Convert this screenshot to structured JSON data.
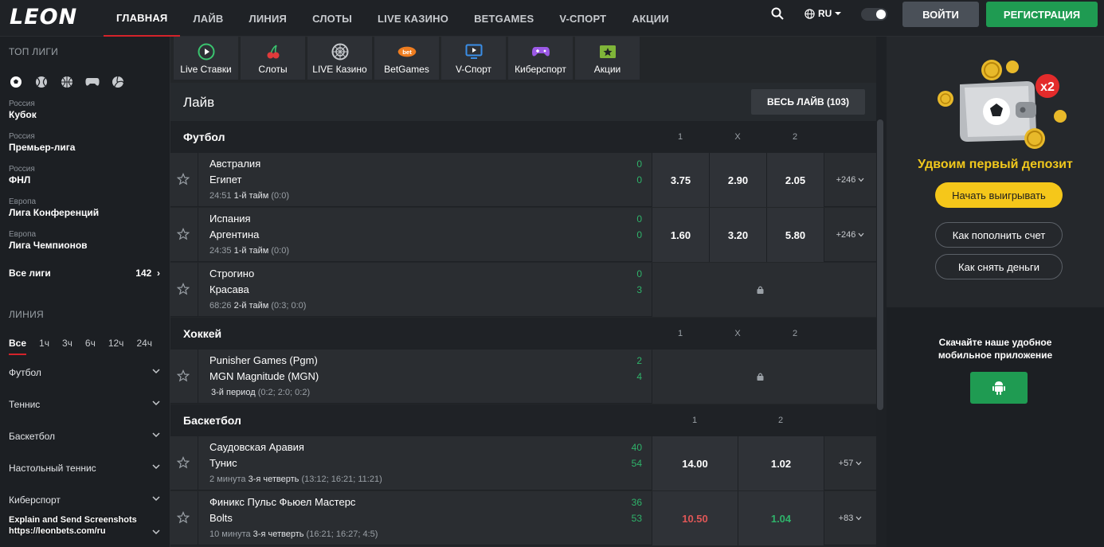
{
  "logo": "LEON",
  "nav": [
    "ГЛАВНАЯ",
    "ЛАЙВ",
    "ЛИНИЯ",
    "СЛОТЫ",
    "LIVE КАЗИНО",
    "BETGAMES",
    "V-СПОРТ",
    "АКЦИИ"
  ],
  "lang": "RU",
  "login": "ВОЙТИ",
  "register": "РЕГИСТРАЦИЯ",
  "sidebar": {
    "top_leagues_title": "ТОП ЛИГИ",
    "leagues": [
      {
        "country": "Россия",
        "name": "Кубок"
      },
      {
        "country": "Россия",
        "name": "Премьер-лига"
      },
      {
        "country": "Россия",
        "name": "ФНЛ"
      },
      {
        "country": "Европа",
        "name": "Лига Конференций"
      },
      {
        "country": "Европа",
        "name": "Лига Чемпионов"
      }
    ],
    "all_leagues": "Все лиги",
    "all_leagues_count": "142",
    "line_title": "ЛИНИЯ",
    "time_filters": [
      "Все",
      "1ч",
      "3ч",
      "6ч",
      "12ч",
      "24ч"
    ],
    "sports": [
      "Футбол",
      "Теннис",
      "Баскетбол",
      "Настольный теннис",
      "Киберспорт"
    ],
    "overlay_line1": "Explain and Send Screenshots",
    "overlay_line2": "https://leonbets.com/ru"
  },
  "quick_links": [
    "Live Ставки",
    "Слоты",
    "LIVE Казино",
    "BetGames",
    "V-Спорт",
    "Киберспорт",
    "Акции"
  ],
  "live": {
    "title": "Лайв",
    "all_live": "ВЕСЬ ЛАЙВ (103)"
  },
  "sections": {
    "football": {
      "title": "Футбол",
      "h1": "1",
      "hx": "X",
      "h2": "2"
    },
    "hockey": {
      "title": "Хоккей",
      "h1": "1",
      "hx": "X",
      "h2": "2"
    },
    "basketball": {
      "title": "Баскетбол",
      "h1": "1",
      "h2": "2"
    }
  },
  "events": {
    "e1": {
      "team1": "Австралия",
      "team2": "Египет",
      "s1": "0",
      "s2": "0",
      "time": "24:51",
      "period": "1-й тайм",
      "extra": "(0:0)",
      "o1": "3.75",
      "ox": "2.90",
      "o2": "2.05",
      "more": "+246"
    },
    "e2": {
      "team1": "Испания",
      "team2": "Аргентина",
      "s1": "0",
      "s2": "0",
      "time": "24:35",
      "period": "1-й тайм",
      "extra": "(0:0)",
      "o1": "1.60",
      "ox": "3.20",
      "o2": "5.80",
      "more": "+246"
    },
    "e3": {
      "team1": "Строгино",
      "team2": "Красава",
      "s1": "0",
      "s2": "3",
      "time": "68:26",
      "period": "2-й тайм",
      "extra": "(0:3; 0:0)"
    },
    "e4": {
      "team1": "Punisher Games (Pgm)",
      "team2": "MGN Magnitude (MGN)",
      "s1": "2",
      "s2": "4",
      "period": "3-й период",
      "extra": "(0:2; 2:0; 0:2)"
    },
    "e5": {
      "team1": "Саудовская Аравия",
      "team2": "Тунис",
      "s1": "40",
      "s2": "54",
      "time": "2 минута",
      "period": "3-я четверть",
      "extra": "(13:12; 16:21; 11:21)",
      "o1": "14.00",
      "o2": "1.02",
      "more": "+57"
    },
    "e6": {
      "team1": "Финикс Пульс Фьюел Мастерс",
      "team2": "Bolts",
      "s1": "36",
      "s2": "53",
      "time": "10 минута",
      "period": "3-я четверть",
      "extra": "(16:21; 16:27; 4:5)",
      "o1": "10.50",
      "o2": "1.04",
      "more": "+83"
    }
  },
  "promo": {
    "badge": "x2",
    "title": "Удвоим первый депозит",
    "start": "Начать выигрывать",
    "deposit_help": "Как пополнить счет",
    "withdraw_help": "Как снять деньги",
    "app_line1": "Скачайте наше удобное",
    "app_line2": "мобильное приложение"
  },
  "colors": {
    "accent_red": "#d4232a",
    "green": "#1f9b52",
    "yellow": "#f5c71a",
    "odds_down": "#e05757",
    "odds_up": "#2fb36a"
  }
}
